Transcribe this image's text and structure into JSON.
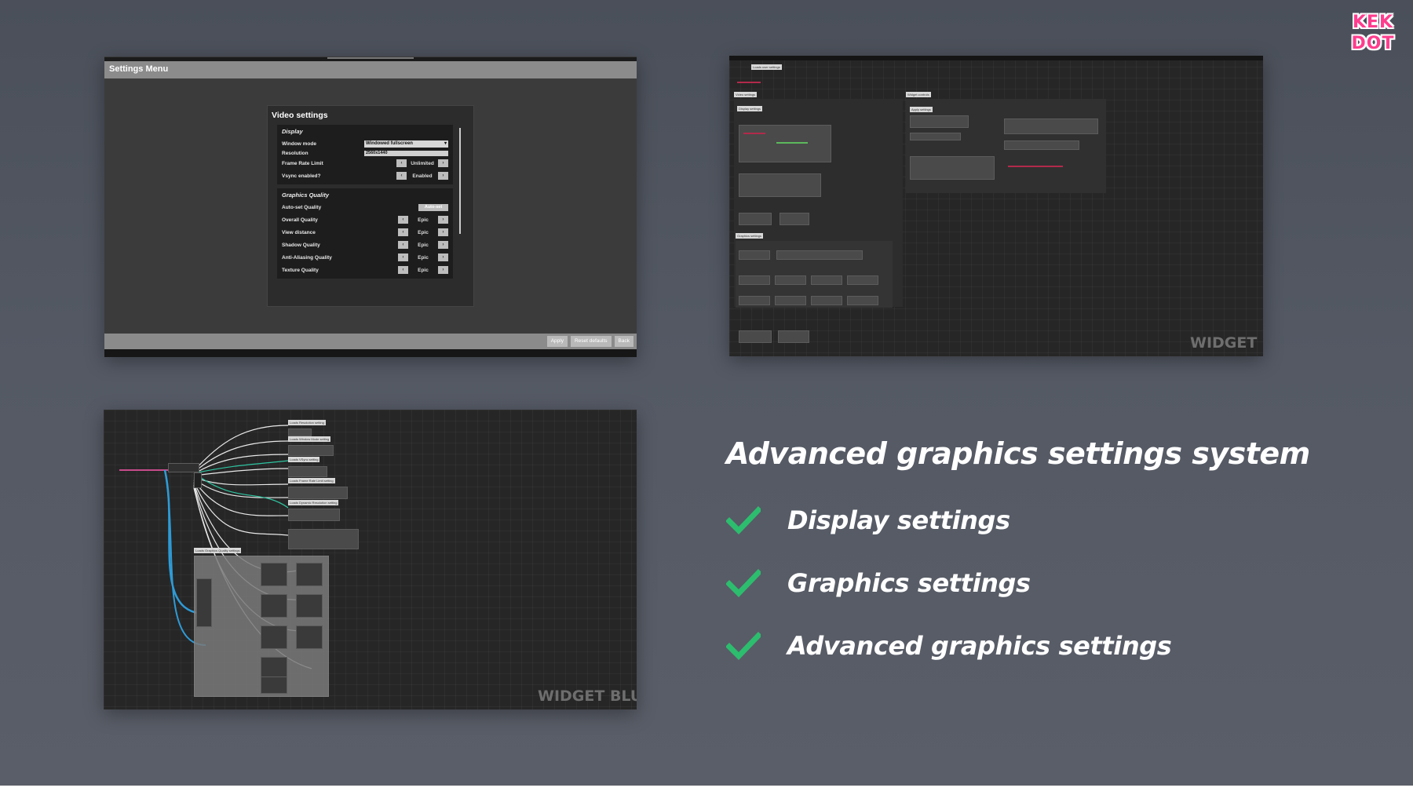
{
  "logo": {
    "line1": "KEK",
    "line2": "DOT"
  },
  "settings_screenshot": {
    "window_title": "Settings Menu",
    "panel_title": "Video settings",
    "display_group": {
      "title": "Display",
      "window_mode_label": "Window mode",
      "window_mode_value": "Windowed fullscreen",
      "resolution_label": "Resolution",
      "resolution_value": "2560x1440",
      "frame_rate_label": "Frame Rate Limit",
      "frame_rate_value": "Unlimited",
      "vsync_label": "Vsync enabled?",
      "vsync_value": "Enabled"
    },
    "graphics_group": {
      "title": "Graphics Quality",
      "auto_set_label": "Auto-set Quality",
      "auto_set_button": "Auto-set",
      "rows": [
        {
          "label": "Overall Quality",
          "value": "Epic"
        },
        {
          "label": "View distance",
          "value": "Epic"
        },
        {
          "label": "Shadow Quality",
          "value": "Epic"
        },
        {
          "label": "Anti-Aliasing Quality",
          "value": "Epic"
        },
        {
          "label": "Texture Quality",
          "value": "Epic"
        }
      ]
    },
    "footer_buttons": {
      "apply": "Apply",
      "reset": "Reset defaults",
      "back": "Back"
    }
  },
  "blueprint_top": {
    "watermark": "WIDGET BL",
    "labels": {
      "load_user_settings": "Loads user settings",
      "video_settings": "Video settings",
      "display_settings": "Display settings",
      "widget_controls": "Widget controls",
      "apply_settings": "Apply settings",
      "graphics_settings": "Graphics settings"
    }
  },
  "blueprint_bottom": {
    "watermark": "WIDGET BLUEP",
    "labels": {
      "resolution": "Loads Resolution setting",
      "window_mode": "Loads Window Mode setting",
      "vsync": "Loads VSync setting",
      "frame_rate": "Loads Frame Rate Limit setting",
      "dynamic_resolution": "Loads Dynamic Resolution setting",
      "graphics_quality": "Loads Graphics Quality settings"
    }
  },
  "headline": "Advanced graphics settings system",
  "features": [
    {
      "label": "Display settings",
      "icon": "checkmark-icon"
    },
    {
      "label": "Graphics settings",
      "icon": "checkmark-icon"
    },
    {
      "label": "Advanced graphics settings",
      "icon": "checkmark-icon"
    }
  ],
  "colors": {
    "check": "#2dbd6e",
    "logo": "#ff3d8e",
    "background": "#50555f"
  }
}
